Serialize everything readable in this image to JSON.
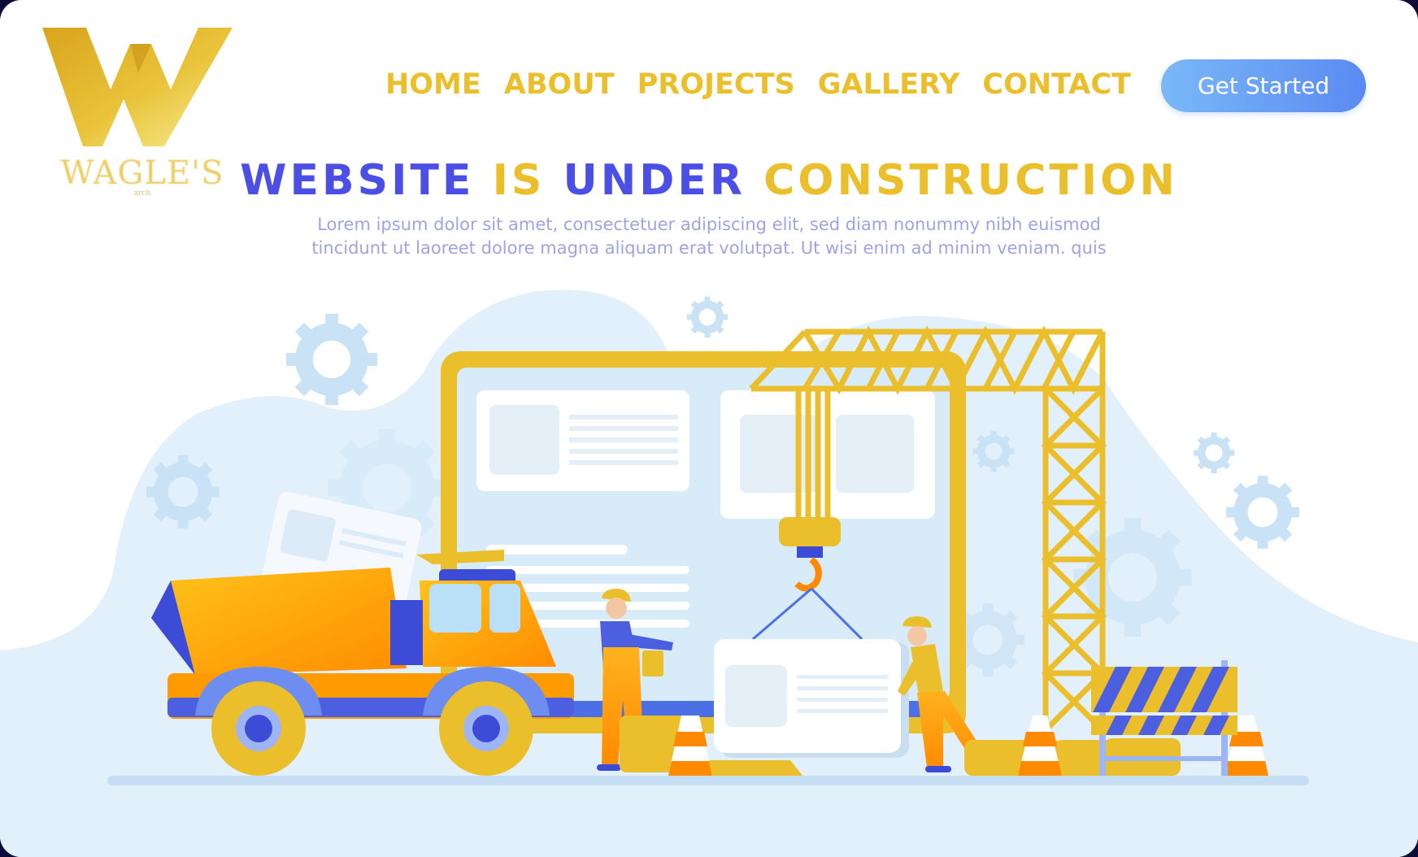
{
  "brand": {
    "name": "WAGLE'S",
    "tagline": "arch",
    "logo_icon": "gold-w-logo-icon",
    "colors": {
      "gold": "#ebbf2c",
      "blue": "#4c4fe6",
      "cta": "#5a8af2"
    }
  },
  "nav": {
    "items": [
      {
        "label": "HOME"
      },
      {
        "label": "ABOUT"
      },
      {
        "label": "PROJECTS"
      },
      {
        "label": "GALLERY"
      },
      {
        "label": "CONTACT"
      }
    ],
    "cta_label": "Get Started"
  },
  "hero": {
    "title_part1": "WEBSITE",
    "title_part2": "IS",
    "title_part3": "UNDER",
    "title_part4": "CONSTRUCTION",
    "paragraph_line1": "Lorem ipsum dolor sit amet, consectetuer adipiscing elit, sed diam nonummy nibh euismod",
    "paragraph_line2": "tincidunt ut laoreet dolore magna aliquam erat volutpat. Ut wisi enim ad minim veniam. quis"
  },
  "illustration": {
    "scene": "construction-scene-illustration",
    "elements": [
      "dump-truck-icon",
      "crane-icon",
      "worker-icon",
      "traffic-cone-icon",
      "road-barrier-icon",
      "gear-icon",
      "browser-window-icon"
    ]
  }
}
